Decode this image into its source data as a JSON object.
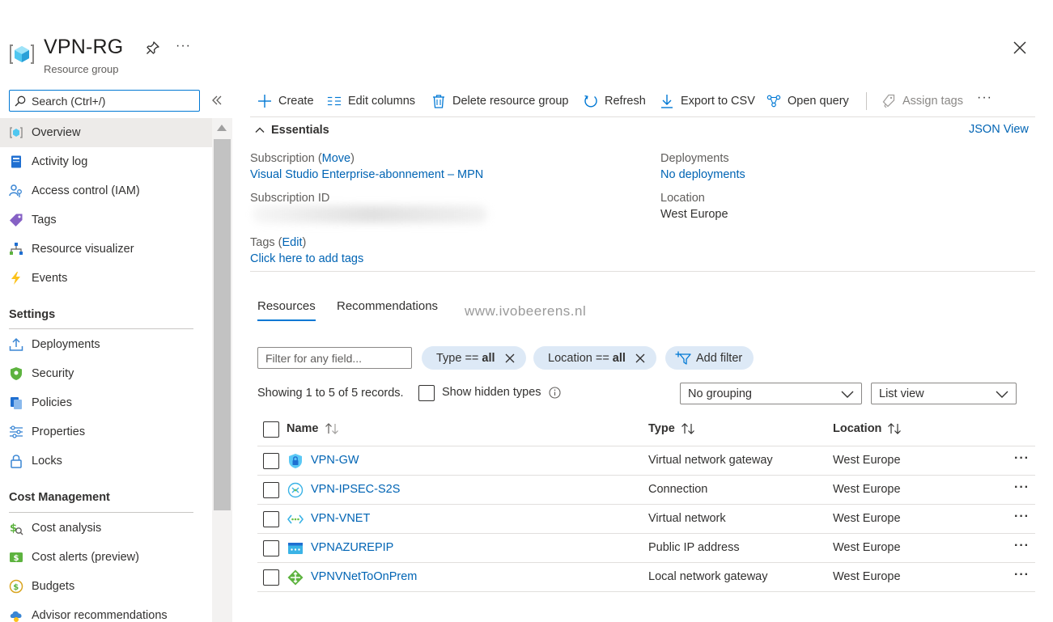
{
  "header": {
    "title": "VPN-RG",
    "subtitle": "Resource group",
    "more": "···"
  },
  "sidebar": {
    "search_placeholder": "Search (Ctrl+/)",
    "items": [
      {
        "label": "Overview"
      },
      {
        "label": "Activity log"
      },
      {
        "label": "Access control (IAM)"
      },
      {
        "label": "Tags"
      },
      {
        "label": "Resource visualizer"
      },
      {
        "label": "Events"
      }
    ],
    "settings": {
      "heading": "Settings",
      "items": [
        {
          "label": "Deployments"
        },
        {
          "label": "Security"
        },
        {
          "label": "Policies"
        },
        {
          "label": "Properties"
        },
        {
          "label": "Locks"
        }
      ]
    },
    "cost": {
      "heading": "Cost Management",
      "items": [
        {
          "label": "Cost analysis"
        },
        {
          "label": "Cost alerts (preview)"
        },
        {
          "label": "Budgets"
        },
        {
          "label": "Advisor recommendations"
        }
      ]
    }
  },
  "toolbar": {
    "create": "Create",
    "edit_columns": "Edit columns",
    "delete": "Delete resource group",
    "refresh": "Refresh",
    "export": "Export to CSV",
    "open_query": "Open query",
    "assign_tags": "Assign tags",
    "more": "···"
  },
  "essentials": {
    "toggle": "Essentials",
    "json_view": "JSON View",
    "subscription_label": "Subscription (",
    "subscription_move": "Move",
    "subscription_label_end": ")",
    "subscription_value": "Visual Studio Enterprise-abonnement – MPN",
    "subscription_id_label": "Subscription ID",
    "tags_label": "Tags (",
    "tags_edit": "Edit",
    "tags_label_end": ")",
    "tags_value": "Click here to add tags",
    "deployments_label": "Deployments",
    "deployments_value": "No deployments",
    "location_label": "Location",
    "location_value": "West Europe"
  },
  "tabs": {
    "resources": "Resources",
    "recommendations": "Recommendations",
    "watermark": "www.ivobeerens.nl"
  },
  "filters": {
    "placeholder": "Filter for any field...",
    "type_label": "Type ==",
    "type_value": "all",
    "location_label": "Location ==",
    "location_value": "all",
    "add_filter": "Add filter"
  },
  "list": {
    "showing": "Showing 1 to 5 of 5 records.",
    "show_hidden": "Show hidden types",
    "grouping": "No grouping",
    "view": "List view",
    "columns": {
      "name": "Name",
      "type": "Type",
      "location": "Location"
    },
    "rows": [
      {
        "name": "VPN-GW",
        "type": "Virtual network gateway",
        "location": "West Europe",
        "icon": "vpn-gateway-icon"
      },
      {
        "name": "VPN-IPSEC-S2S",
        "type": "Connection",
        "location": "West Europe",
        "icon": "connection-icon"
      },
      {
        "name": "VPN-VNET",
        "type": "Virtual network",
        "location": "West Europe",
        "icon": "vnet-icon"
      },
      {
        "name": "VPNAZUREPIP",
        "type": "Public IP address",
        "location": "West Europe",
        "icon": "public-ip-icon"
      },
      {
        "name": "VPNVNetToOnPrem",
        "type": "Local network gateway",
        "location": "West Europe",
        "icon": "local-gateway-icon"
      }
    ],
    "row_more": "···"
  },
  "colors": {
    "accent": "#0078d4",
    "link": "#0064b4",
    "pill": "#dde9f6",
    "selected_nav": "#edebe9"
  }
}
